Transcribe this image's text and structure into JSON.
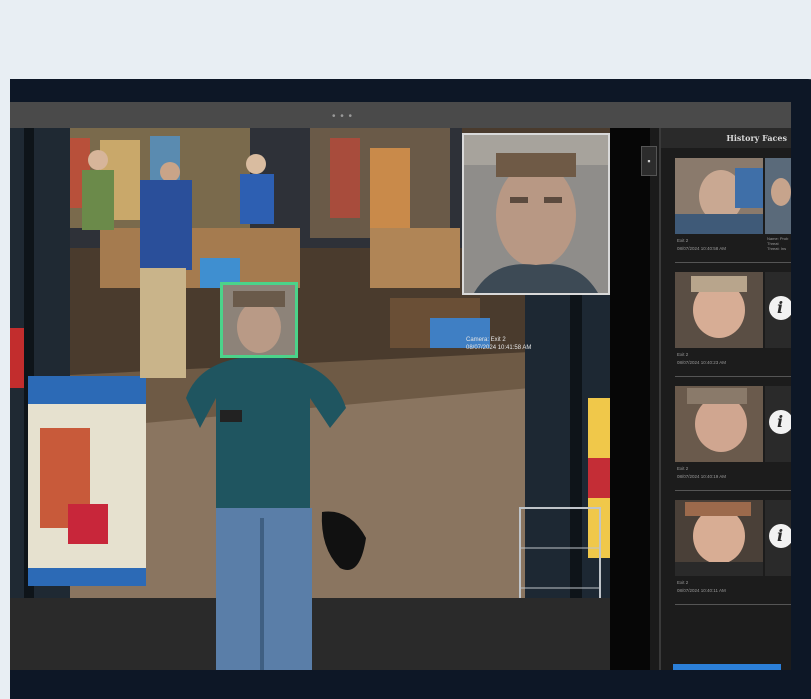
{
  "overlay": {
    "camera_label": "Camera: Exit 2",
    "camera_timestamp": "08/07/2024 10:41:58 AM"
  },
  "side_button": {
    "icon": "save-icon",
    "glyph": "▪"
  },
  "panel": {
    "title": "History Faces",
    "cards": [
      {
        "camera": "Exit 2",
        "time": "08/07/2024 10:40:58 AM",
        "meta": "Name: Prob\nThreat\nThreat: Ins",
        "has_logo": false
      },
      {
        "camera": "Exit 2",
        "time": "08/07/2024 10:40:23 AM",
        "meta": "",
        "has_logo": true
      },
      {
        "camera": "Exit 2",
        "time": "08/07/2024 10:40:19 AM",
        "meta": "",
        "has_logo": true
      },
      {
        "camera": "Exit 2",
        "time": "08/07/2024 10:40:11 AM",
        "meta": "",
        "has_logo": true
      }
    ],
    "logo_glyph": "i"
  },
  "colors": {
    "face_box": "#4bd38a",
    "bezel": "#0d1726",
    "page_bg": "#e8eef3",
    "accent": "#2b7fd8"
  }
}
